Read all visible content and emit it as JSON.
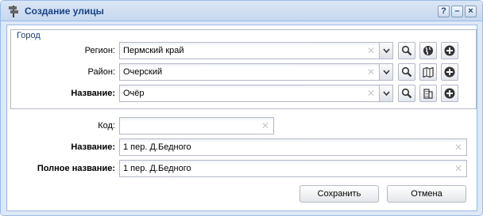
{
  "window": {
    "title": "Создание улицы",
    "tools": {
      "help": "?",
      "minimize": "–",
      "close": "×"
    }
  },
  "city_group": {
    "legend": "Город",
    "region": {
      "label": "Регион:",
      "value": "Пермский край"
    },
    "district": {
      "label": "Район:",
      "value": "Очерский"
    },
    "name": {
      "label": "Название:",
      "value": "Очёр"
    }
  },
  "street": {
    "code": {
      "label": "Код:",
      "value": ""
    },
    "name": {
      "label": "Название:",
      "value": "1 пер. Д.Бедного"
    },
    "full_name": {
      "label": "Полное название:",
      "value": "1 пер. Д.Бедного"
    }
  },
  "buttons": {
    "save": "Сохранить",
    "cancel": "Отмена"
  },
  "colors": {
    "title_text": "#15428b",
    "frame_border": "#99bbe8",
    "frame_bg": "#dfe8f6"
  },
  "icons": [
    "signpost-icon",
    "search-icon",
    "globe-icon",
    "map-icon",
    "building-icon",
    "add-icon",
    "clear-icon",
    "dropdown-arrow-icon"
  ]
}
